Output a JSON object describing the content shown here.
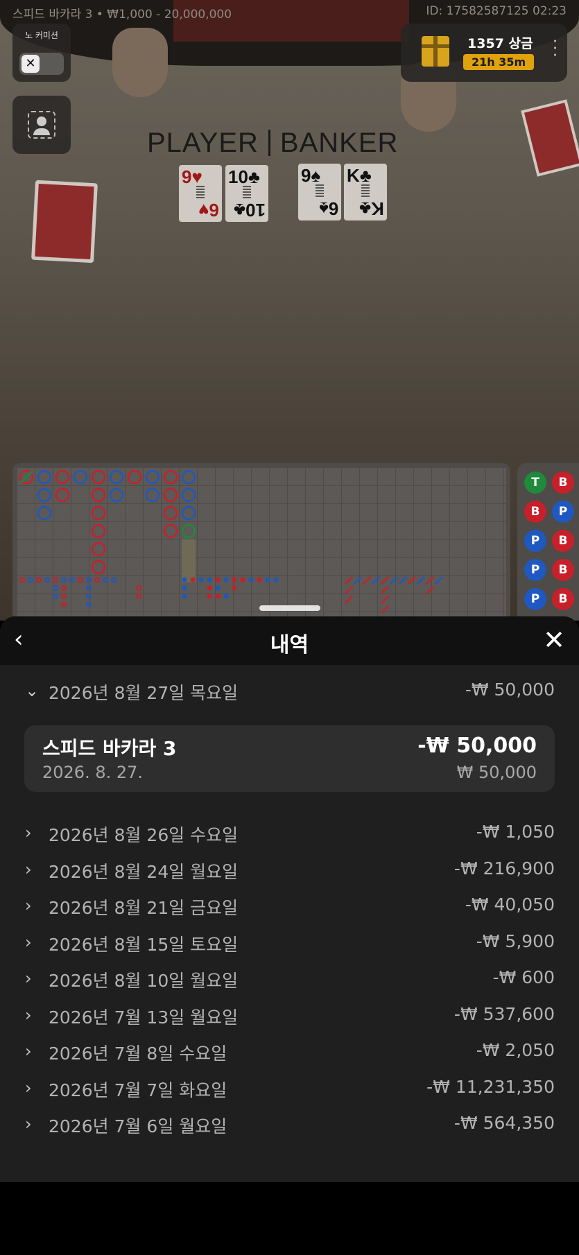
{
  "stream_info": {
    "title": "스피드 바카라 3 • ₩1,000 - 20,000,000",
    "id_time": "ID: 17582587125 02:23"
  },
  "left_controls": {
    "no_commission_label": "노 커미션",
    "toggle_icon": "x-icon"
  },
  "prize": {
    "label": "1357 상금",
    "timer": "21h 35m"
  },
  "table": {
    "player_label": "PLAYER",
    "banker_label": "BANKER",
    "player_cards": [
      {
        "rank": "9",
        "suit": "♥",
        "rank2": "6",
        "suit2": "♥",
        "color": "red"
      },
      {
        "rank": "10",
        "suit": "♣",
        "rank2": "10",
        "suit2": "♣",
        "color": "black"
      }
    ],
    "banker_cards": [
      {
        "rank": "9",
        "suit": "♠",
        "rank2": "6",
        "suit2": "♠",
        "color": "black"
      },
      {
        "rank": "K",
        "suit": "♣",
        "rank2": "K",
        "suit2": "♣",
        "color": "black"
      }
    ]
  },
  "bead_road": [
    {
      "label": "T",
      "color": "#1f8a3a"
    },
    {
      "label": "B",
      "color": "#c8202a"
    },
    {
      "label": "B",
      "color": "#c8202a"
    },
    {
      "label": "P",
      "color": "#1f58c0"
    },
    {
      "label": "P",
      "color": "#1f58c0"
    },
    {
      "label": "B",
      "color": "#c8202a"
    },
    {
      "label": "P",
      "color": "#1f58c0"
    },
    {
      "label": "B",
      "color": "#c8202a"
    },
    {
      "label": "P",
      "color": "#1f58c0"
    },
    {
      "label": "B",
      "color": "#c8202a"
    }
  ],
  "history": {
    "title": "내역",
    "expanded_day": {
      "date": "2026년 8월 27일 목요일",
      "amount": "-₩ 50,000"
    },
    "entry": {
      "game": "스피드 바카라 3",
      "result": "-₩ 50,000",
      "date": "2026. 8. 27.",
      "stake": "₩ 50,000"
    },
    "days": [
      {
        "date": "2026년 8월 26일 수요일",
        "amount": "-₩ 1,050"
      },
      {
        "date": "2026년 8월 24일 월요일",
        "amount": "-₩ 216,900"
      },
      {
        "date": "2026년 8월 21일 금요일",
        "amount": "-₩ 40,050"
      },
      {
        "date": "2026년 8월 15일 토요일",
        "amount": "-₩ 5,900"
      },
      {
        "date": "2026년 8월 10일 월요일",
        "amount": "-₩ 600"
      },
      {
        "date": "2026년 7월 13일 월요일",
        "amount": "-₩ 537,600"
      },
      {
        "date": "2026년 7월 8일 수요일",
        "amount": "-₩ 2,050"
      },
      {
        "date": "2026년 7월 7일 화요일",
        "amount": "-₩ 11,231,350"
      },
      {
        "date": "2026년 7월 6일 월요일",
        "amount": "-₩ 564,350"
      }
    ]
  }
}
